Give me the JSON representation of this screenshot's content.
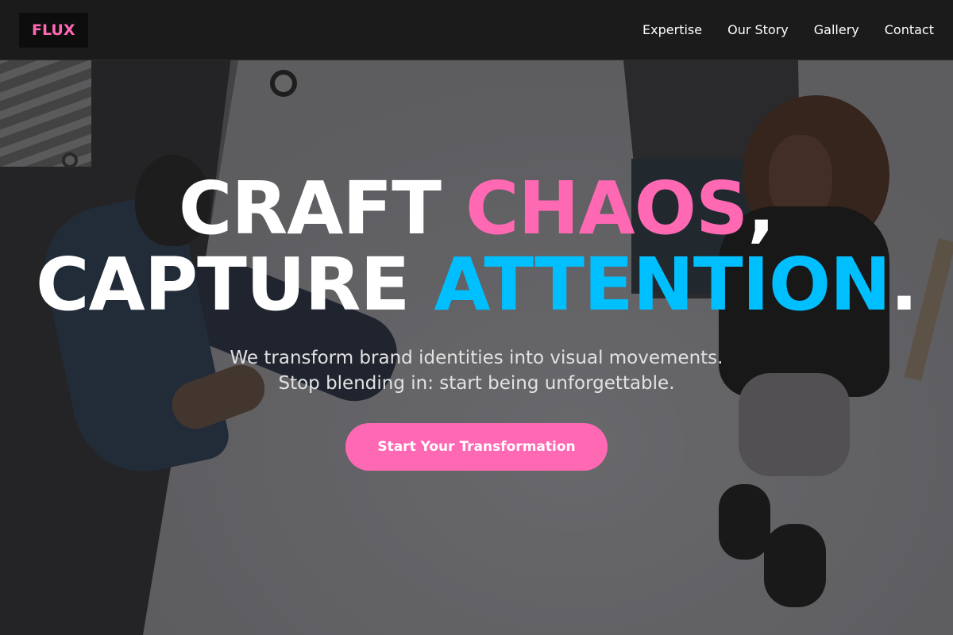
{
  "brand": {
    "logo_text": "FLUX",
    "accent_pink": "#ff69b4",
    "accent_blue": "#00bfff"
  },
  "nav": {
    "links": [
      {
        "label": "Expertise"
      },
      {
        "label": "Our Story"
      },
      {
        "label": "Gallery"
      },
      {
        "label": "Contact"
      }
    ]
  },
  "hero": {
    "headline_line1_a": "CRAFT ",
    "headline_line1_b": "CHAOS",
    "headline_line1_c": ",",
    "headline_line2_a": "CAPTURE ",
    "headline_line2_b": "ATTENTION",
    "headline_line2_c": ".",
    "subtitle_line1": "We transform brand identities into visual movements.",
    "subtitle_line2": "Stop blending in: start being unforgettable.",
    "cta_label": "Start Your Transformation"
  }
}
